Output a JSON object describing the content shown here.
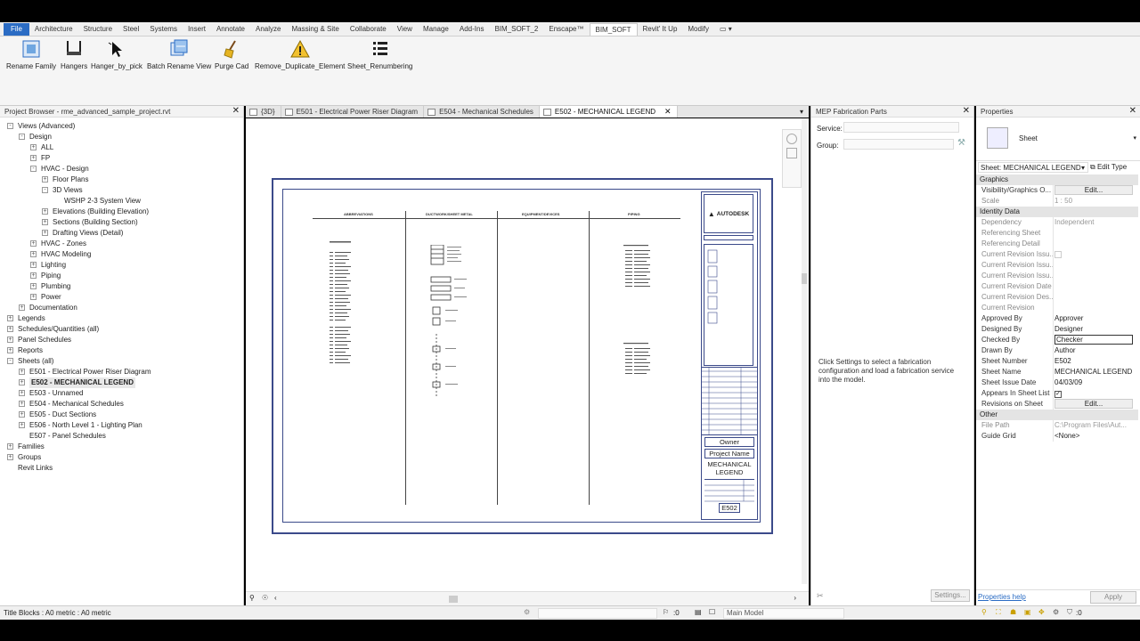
{
  "ribbon_tabs": [
    "File",
    "Architecture",
    "Structure",
    "Steel",
    "Systems",
    "Insert",
    "Annotate",
    "Analyze",
    "Massing & Site",
    "Collaborate",
    "View",
    "Manage",
    "Add-Ins",
    "BIM_SOFT_2",
    "Enscape™",
    "BIM_SOFT",
    "Revit' It Up",
    "Modify"
  ],
  "ribbon_buttons": [
    "Rename Family",
    "Hangers",
    "Hanger_by_pick",
    "Batch Rename View",
    "Purge Cad",
    "Remove_Duplicate_Element",
    "Sheet_Renumbering"
  ],
  "project_browser": {
    "title": "Project Browser - rme_advanced_sample_project.rvt",
    "items": [
      {
        "label": "Views (Advanced)",
        "depth": 0,
        "toggle": "-"
      },
      {
        "label": "Design",
        "depth": 1,
        "toggle": "-"
      },
      {
        "label": "ALL",
        "depth": 2,
        "toggle": "+"
      },
      {
        "label": "FP",
        "depth": 2,
        "toggle": "+"
      },
      {
        "label": "HVAC - Design",
        "depth": 2,
        "toggle": "-"
      },
      {
        "label": "Floor Plans",
        "depth": 3,
        "toggle": "+"
      },
      {
        "label": "3D Views",
        "depth": 3,
        "toggle": "-"
      },
      {
        "label": "WSHP 2-3 System View",
        "depth": 4,
        "toggle": ""
      },
      {
        "label": "Elevations (Building Elevation)",
        "depth": 3,
        "toggle": "+"
      },
      {
        "label": "Sections (Building Section)",
        "depth": 3,
        "toggle": "+"
      },
      {
        "label": "Drafting Views (Detail)",
        "depth": 3,
        "toggle": "+"
      },
      {
        "label": "HVAC - Zones",
        "depth": 2,
        "toggle": "+"
      },
      {
        "label": "HVAC Modeling",
        "depth": 2,
        "toggle": "+"
      },
      {
        "label": "Lighting",
        "depth": 2,
        "toggle": "+"
      },
      {
        "label": "Piping",
        "depth": 2,
        "toggle": "+"
      },
      {
        "label": "Plumbing",
        "depth": 2,
        "toggle": "+"
      },
      {
        "label": "Power",
        "depth": 2,
        "toggle": "+"
      },
      {
        "label": "Documentation",
        "depth": 1,
        "toggle": "+"
      },
      {
        "label": "Legends",
        "depth": 0,
        "toggle": "+"
      },
      {
        "label": "Schedules/Quantities (all)",
        "depth": 0,
        "toggle": "+"
      },
      {
        "label": "Panel Schedules",
        "depth": 0,
        "toggle": "+"
      },
      {
        "label": "Reports",
        "depth": 0,
        "toggle": "+"
      },
      {
        "label": "Sheets (all)",
        "depth": 0,
        "toggle": "-"
      },
      {
        "label": "E501 - Electrical Power Riser Diagram",
        "depth": 1,
        "toggle": "+"
      },
      {
        "label": "E502 - MECHANICAL LEGEND",
        "depth": 1,
        "toggle": "+",
        "selected": true
      },
      {
        "label": "E503 - Unnamed",
        "depth": 1,
        "toggle": "+"
      },
      {
        "label": "E504 - Mechanical Schedules",
        "depth": 1,
        "toggle": "+"
      },
      {
        "label": "E505 - Duct Sections",
        "depth": 1,
        "toggle": "+"
      },
      {
        "label": "E506 - North Level 1 - Lighting Plan",
        "depth": 1,
        "toggle": "+"
      },
      {
        "label": "E507 - Panel Schedules",
        "depth": 1,
        "toggle": ""
      },
      {
        "label": "Families",
        "depth": 0,
        "toggle": "+"
      },
      {
        "label": "Groups",
        "depth": 0,
        "toggle": "+"
      },
      {
        "label": "Revit Links",
        "depth": 0,
        "toggle": ""
      }
    ]
  },
  "view_tabs": [
    "{3D}",
    "E501 - Electrical Power Riser Diagram",
    "E504 - Mechanical Schedules",
    "E502 - MECHANICAL LEGEND"
  ],
  "sheet": {
    "col_headers": [
      "ABBREVIATIONS",
      "DUCTWORK/SHEET METAL",
      "EQUIPMENT/DEVICES",
      "PIPING"
    ],
    "logo": "AUTODESK",
    "owner": "Owner",
    "project_name": "Project Name",
    "sheet_title": "MECHANICAL LEGEND",
    "sheet_number": "E502"
  },
  "fab_parts": {
    "title": "MEP Fabrication Parts",
    "service_label": "Service:",
    "group_label": "Group:",
    "message": "Click Settings to select a fabrication configuration and load a fabrication service into the model.",
    "settings_button": "Settings..."
  },
  "properties": {
    "title": "Properties",
    "type_name": "Sheet",
    "selector": "Sheet: MECHANICAL LEGEND",
    "edit_type": "Edit Type",
    "sections": [
      {
        "name": "Graphics",
        "rows": [
          {
            "k": "Visibility/Graphics O...",
            "v": "Edit...",
            "button": true
          },
          {
            "k": "Scale",
            "v": "1 : 50",
            "dim": true
          }
        ]
      },
      {
        "name": "Identity Data",
        "rows": [
          {
            "k": "Dependency",
            "v": "Independent",
            "dim": true
          },
          {
            "k": "Referencing Sheet",
            "v": "",
            "dim": true
          },
          {
            "k": "Referencing Detail",
            "v": "",
            "dim": true
          },
          {
            "k": "Current Revision Issu...",
            "v": "",
            "dim": true,
            "check": true
          },
          {
            "k": "Current Revision Issu...",
            "v": "",
            "dim": true
          },
          {
            "k": "Current Revision Issu...",
            "v": "",
            "dim": true
          },
          {
            "k": "Current Revision Date",
            "v": "",
            "dim": true
          },
          {
            "k": "Current Revision Des...",
            "v": "",
            "dim": true
          },
          {
            "k": "Current Revision",
            "v": "",
            "dim": true
          },
          {
            "k": "Approved By",
            "v": "Approver"
          },
          {
            "k": "Designed By",
            "v": "Designer"
          },
          {
            "k": "Checked By",
            "v": "Checker",
            "boxed": true
          },
          {
            "k": "Drawn By",
            "v": "Author"
          },
          {
            "k": "Sheet Number",
            "v": "E502"
          },
          {
            "k": "Sheet Name",
            "v": "MECHANICAL LEGEND"
          },
          {
            "k": "Sheet Issue Date",
            "v": "04/03/09"
          },
          {
            "k": "Appears In Sheet List",
            "v": "",
            "checked": true
          },
          {
            "k": "Revisions on Sheet",
            "v": "Edit...",
            "button": true
          }
        ]
      },
      {
        "name": "Other",
        "rows": [
          {
            "k": "File Path",
            "v": "C:\\Program Files\\Aut...",
            "dim": true
          },
          {
            "k": "Guide Grid",
            "v": "<None>"
          }
        ]
      }
    ],
    "help_link": "Properties help",
    "apply_button": "Apply"
  },
  "status": {
    "text": "Title Blocks : A0 metric : A0 metric",
    "zero": ":0",
    "model": "Main Model",
    "filter": ":0"
  },
  "colors": {
    "accent": "#2b6cc4",
    "sheet_border": "#3b4a8a"
  }
}
